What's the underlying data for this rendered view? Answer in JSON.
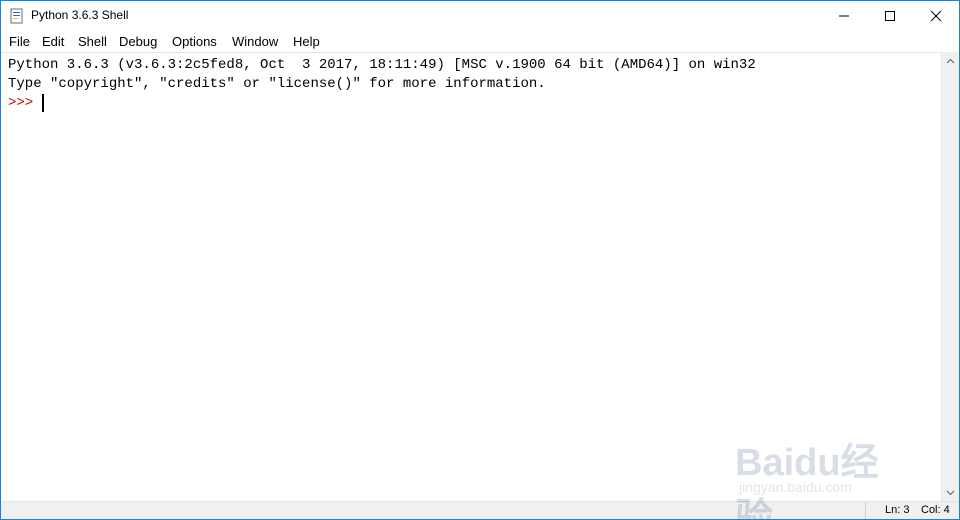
{
  "window": {
    "title": "Python 3.6.3 Shell",
    "icons": {
      "app": "python-idle-icon",
      "minimize": "minimize-icon",
      "maximize": "maximize-icon",
      "close": "close-icon"
    }
  },
  "menu": {
    "items": [
      "File",
      "Edit",
      "Shell",
      "Debug",
      "Options",
      "Window",
      "Help"
    ]
  },
  "editor": {
    "lines": [
      "Python 3.6.3 (v3.6.3:2c5fed8, Oct  3 2017, 18:11:49) [MSC v.1900 64 bit (AMD64)] on win32",
      "Type \"copyright\", \"credits\" or \"license()\" for more information."
    ],
    "prompt": ">>> "
  },
  "status": {
    "ln": "Ln: 3",
    "col": "Col: 4"
  },
  "watermark": {
    "logo": "Baidu经验",
    "url": "jingyan.baidu.com"
  },
  "colors": {
    "prompt": "#c00000",
    "window_border": "#1883d7"
  }
}
